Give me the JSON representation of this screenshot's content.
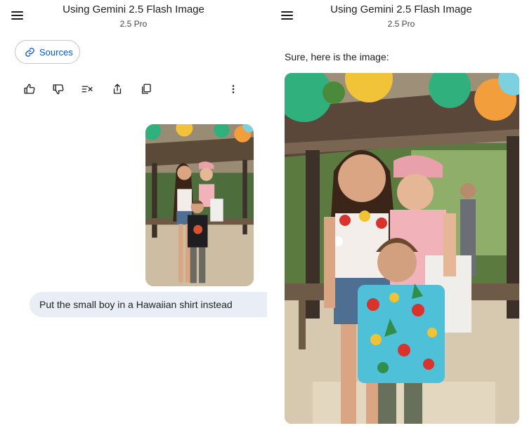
{
  "header": {
    "title": "Using Gemini 2.5 Flash Image",
    "model": "2.5 Pro"
  },
  "sources_button": {
    "label": "Sources"
  },
  "actions": [
    "thumbs-up",
    "thumbs-down",
    "modify-response",
    "share",
    "copy",
    "more-options"
  ],
  "conversation": {
    "user_prompt": "Put the small boy in a Hawaiian shirt instead",
    "model_reply": "Sure, here is the image:"
  },
  "colors": {
    "accent": "#0b57d0",
    "bubble": "#e9eef6",
    "text": "#1f1f1f",
    "muted": "#444746"
  }
}
